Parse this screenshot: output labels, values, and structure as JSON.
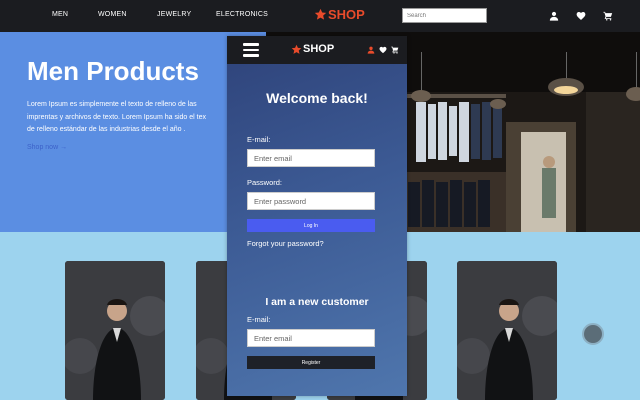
{
  "nav": {
    "links": [
      "MEN",
      "WOMEN",
      "JEWELRY",
      "ELECTRONICS"
    ],
    "logo_text": "SHOP",
    "search_placeholder": "Search"
  },
  "hero": {
    "title": "Men Products",
    "text_lines": [
      "Lorem Ipsum es simplemente el texto de relleno de las",
      "imprentas y archivos de texto. Lorem Ipsum ha sido el tex",
      "de relleno estándar de las industrias desde el año ."
    ],
    "link": "Shop now →"
  },
  "mobile": {
    "logo_text": "SHOP",
    "welcome": "Welcome back!",
    "email_label": "E-mail:",
    "email_placeholder": "Enter email",
    "password_label": "Password:",
    "password_placeholder": "Enter password",
    "login_button": "Log In",
    "forgot": "Forgot your password?",
    "new_customer": "I am a new customer",
    "register_email_label": "E-mail:",
    "register_email_placeholder": "Enter email",
    "register_button": "Register"
  },
  "icons": {
    "nav": [
      "user-icon",
      "heart-icon",
      "cart-icon"
    ],
    "star": "star-icon",
    "menu": "hamburger-menu-icon"
  },
  "colors": {
    "nav_bg": "#1b1c20",
    "logo_red": "#e94b2b",
    "hero_blue": "#5b8ee2",
    "page_bg": "#9dd3ee",
    "login_button": "#4a5cf0"
  }
}
